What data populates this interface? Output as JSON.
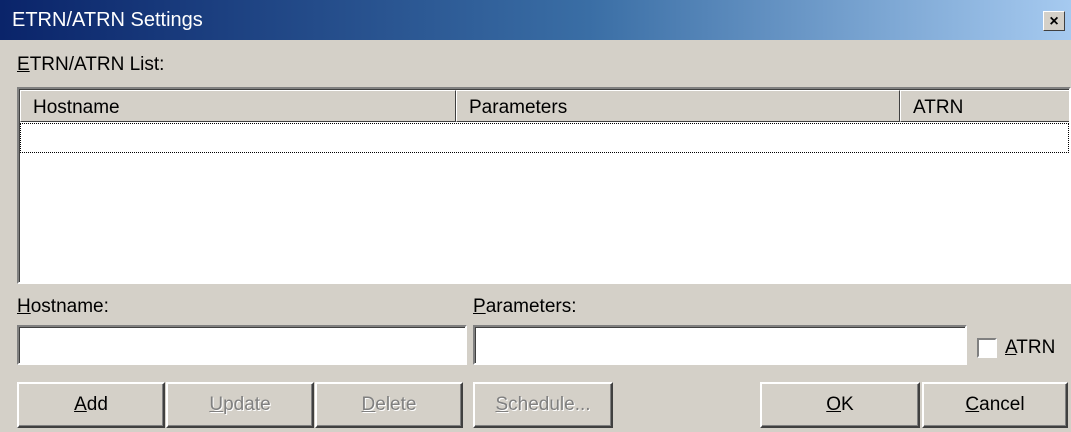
{
  "window": {
    "title": "ETRN/ATRN Settings",
    "close_glyph": "×"
  },
  "list": {
    "label_accel": "E",
    "label_rest": "TRN/ATRN List:",
    "columns": [
      "Hostname",
      "Parameters",
      "ATRN"
    ]
  },
  "form": {
    "hostname_label_accel": "H",
    "hostname_label_rest": "ostname:",
    "hostname_value": "",
    "parameters_label_accel": "P",
    "parameters_label_rest": "arameters:",
    "parameters_value": "",
    "atrn_label_accel": "A",
    "atrn_label_rest": "TRN",
    "atrn_checked": false
  },
  "buttons": {
    "add_accel": "A",
    "add_rest": "dd",
    "update_accel": "U",
    "update_rest": "pdate",
    "delete_accel": "D",
    "delete_rest": "elete",
    "schedule_accel": "S",
    "schedule_rest": "chedule...",
    "ok_accel": "O",
    "ok_rest": "K",
    "cancel_accel": "C",
    "cancel_rest": "ancel"
  }
}
